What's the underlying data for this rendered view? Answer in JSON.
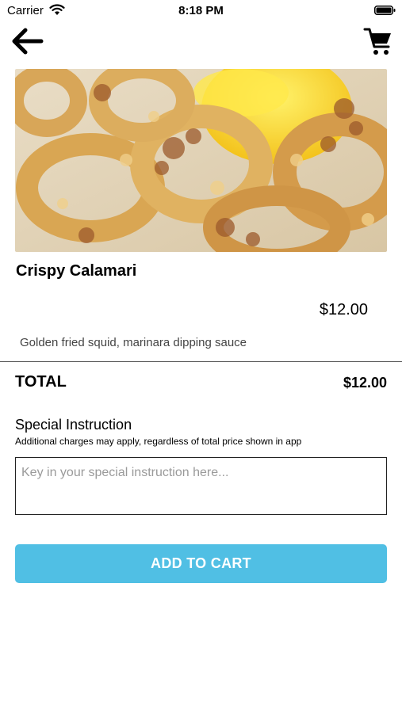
{
  "status_bar": {
    "carrier": "Carrier",
    "time": "8:18 PM"
  },
  "header": {
    "back_icon": "arrow-left-icon",
    "cart_icon": "shopping-cart-icon"
  },
  "item": {
    "image_alt": "Crispy Calamari",
    "name": "Crispy Calamari",
    "price": "$12.00",
    "description": "Golden fried squid, marinara dipping sauce"
  },
  "total": {
    "label": "TOTAL",
    "value": "$12.00"
  },
  "special_instruction": {
    "title": "Special Instruction",
    "note": "Additional charges may apply, regardless of total price shown in app",
    "placeholder": "Key in your special instruction here...",
    "value": ""
  },
  "actions": {
    "add_to_cart": "ADD TO CART"
  },
  "colors": {
    "accent": "#50bfe4"
  }
}
